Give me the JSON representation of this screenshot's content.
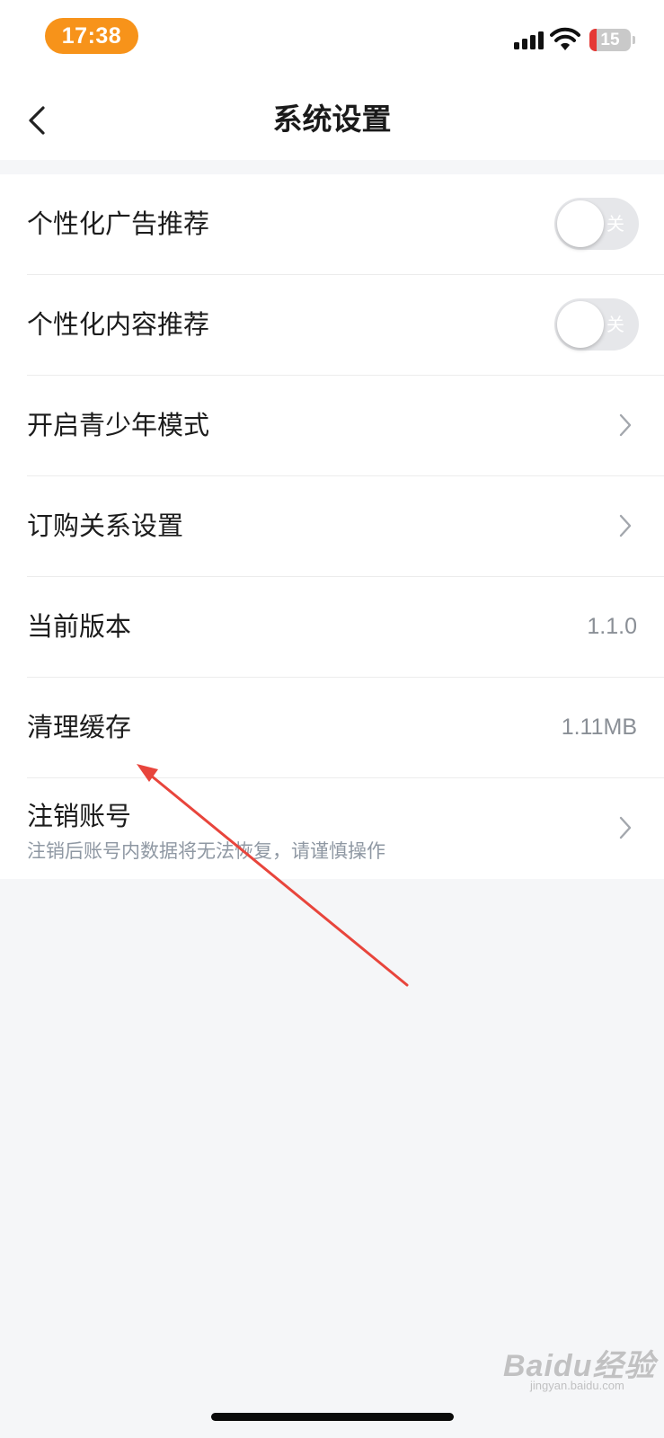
{
  "status_bar": {
    "time": "17:38",
    "battery": "15",
    "icons": [
      "signal-icon",
      "wifi-icon",
      "battery-icon"
    ],
    "time_pill_color": "#f7931a"
  },
  "header": {
    "title": "系统设置",
    "back_icon": "chevron-left-icon"
  },
  "settings": {
    "items": [
      {
        "label": "个性化广告推荐",
        "control": "toggle",
        "toggle_text": "关",
        "state": "off"
      },
      {
        "label": "个性化内容推荐",
        "control": "toggle",
        "toggle_text": "关",
        "state": "off"
      },
      {
        "label": "开启青少年模式",
        "control": "chevron"
      },
      {
        "label": "订购关系设置",
        "control": "chevron"
      },
      {
        "label": "当前版本",
        "value": "1.1.0"
      },
      {
        "label": "清理缓存",
        "value": "1.11MB"
      },
      {
        "label": "注销账号",
        "sublabel": "注销后账号内数据将无法恢复，请谨慎操作",
        "control": "chevron"
      }
    ]
  },
  "annotation": {
    "type": "arrow",
    "color": "#e8453c",
    "points_to": "清理缓存"
  },
  "watermark": {
    "logo": "Baidu经验",
    "sub": "jingyan.baidu.com"
  },
  "colors": {
    "background": "#f5f6f8",
    "card": "#ffffff",
    "annotation": "#e8453c"
  }
}
